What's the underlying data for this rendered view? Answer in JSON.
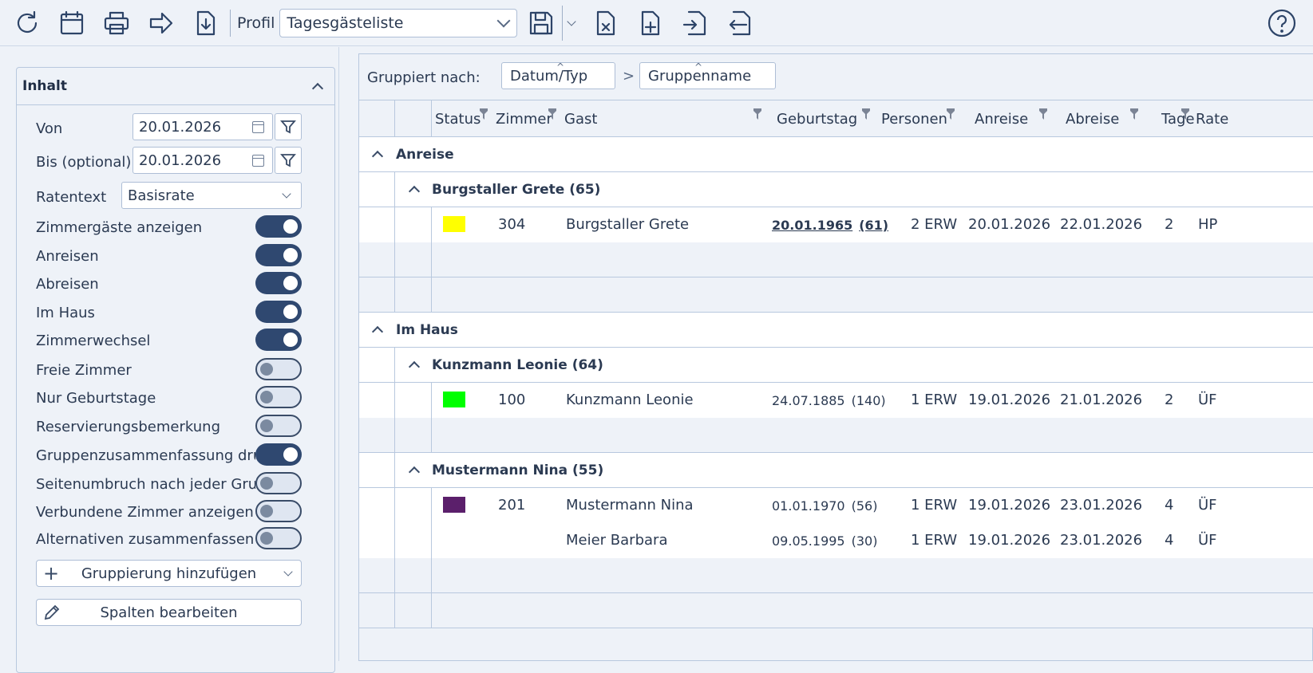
{
  "toolbar": {
    "icons": [
      "refresh-icon",
      "calendar-icon",
      "print-icon",
      "forward-icon",
      "download-icon"
    ],
    "profil_label": "Profil",
    "profil_value": "Tagesgästeliste",
    "right_icons": [
      "save-icon",
      "excel-x-icon",
      "file-plus-icon",
      "file-import-icon",
      "file-export-icon"
    ],
    "help_icon": "help-icon"
  },
  "sidebar": {
    "title": "Inhalt",
    "von_label": "Von",
    "von_value": "20.01.2026",
    "bis_label": "Bis (optional)",
    "bis_value": "20.01.2026",
    "ratentext_label": "Ratentext",
    "ratentext_value": "Basisrate",
    "toggles": [
      {
        "label": "Zimmergäste anzeigen",
        "on": true
      },
      {
        "label": "Anreisen",
        "on": true
      },
      {
        "label": "Abreisen",
        "on": true
      },
      {
        "label": "Im Haus",
        "on": true
      },
      {
        "label": "Zimmerwechsel",
        "on": true
      },
      {
        "label": "Freie Zimmer",
        "on": false
      },
      {
        "label": "Nur Geburtstage",
        "on": false
      },
      {
        "label": "Reservierungsbemerkung",
        "on": false
      },
      {
        "label": "Gruppenzusammenfassung dru",
        "on": true
      },
      {
        "label": "Seitenumbruch nach jeder Grupp",
        "on": false
      },
      {
        "label": "Verbundene Zimmer anzeigen",
        "on": false
      },
      {
        "label": "Alternativen zusammenfassen",
        "on": false
      }
    ],
    "add_group_label": "Gruppierung hinzufügen",
    "edit_columns_label": "Spalten bearbeiten"
  },
  "grouping": {
    "label": "Gruppiert nach:",
    "chip1": "Datum/Typ",
    "chip2": "Gruppenname",
    "arrow": ">"
  },
  "columns": [
    "Status",
    "Zimmer",
    "Gast",
    "Geburtstag",
    "Personen",
    "Anreise",
    "Abreise",
    "Tage",
    "Rate"
  ],
  "groups": [
    {
      "title": "Anreise",
      "subgroups": [
        {
          "title": "Burgstaller Grete (65)",
          "rows": [
            {
              "color": "#ffff00",
              "zimmer": "304",
              "gast": "Burgstaller Grete",
              "geburtstag": "20.01.1965",
              "alter": "(61)",
              "personen": "2 ERW",
              "anreise": "20.01.2026",
              "abreise": "22.01.2026",
              "tage": "2",
              "rate": "HP",
              "birthday_today": true
            }
          ]
        }
      ]
    },
    {
      "title": "Im Haus",
      "subgroups": [
        {
          "title": "Kunzmann Leonie (64)",
          "rows": [
            {
              "color": "#00ff00",
              "zimmer": "100",
              "gast": "Kunzmann Leonie",
              "geburtstag": "24.07.1885",
              "alter": "(140)",
              "personen": "1 ERW",
              "anreise": "19.01.2026",
              "abreise": "21.01.2026",
              "tage": "2",
              "rate": "ÜF"
            }
          ]
        },
        {
          "title": "Mustermann Nina (55)",
          "rows": [
            {
              "color": "#5b1f6b",
              "zimmer": "201",
              "gast": "Mustermann Nina",
              "geburtstag": "01.01.1970",
              "alter": "(56)",
              "personen": "1 ERW",
              "anreise": "19.01.2026",
              "abreise": "23.01.2026",
              "tage": "4",
              "rate": "ÜF"
            },
            {
              "zimmer": "",
              "gast": "Meier Barbara",
              "geburtstag": "09.05.1995",
              "alter": "(30)",
              "personen": "1 ERW",
              "anreise": "19.01.2026",
              "abreise": "23.01.2026",
              "tage": "4",
              "rate": "ÜF"
            }
          ]
        }
      ]
    }
  ]
}
